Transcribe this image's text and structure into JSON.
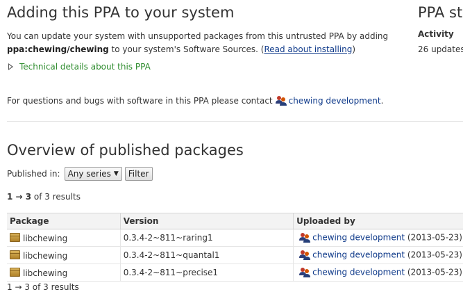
{
  "main": {
    "title": "Adding this PPA to your system",
    "intro_text": "You can update your system with unsupported packages from this untrusted PPA by adding",
    "ppa_name": "ppa:chewing/chewing",
    "intro_suffix": "to your system's Software Sources. (",
    "read_link": "Read about installing",
    "intro_close": ")",
    "details_label": "Technical details about this PPA",
    "contact_text": "For questions and bugs with software in this PPA please contact",
    "contact_link": "chewing development",
    "contact_end": "."
  },
  "sidebar": {
    "title": "PPA st",
    "activity_heading": "Activity",
    "updates_text": "26 updates a"
  },
  "overview": {
    "heading": "Overview of published packages",
    "published_label": "Published in:",
    "series_selected": "Any series",
    "filter_button": "Filter",
    "results_range": "1 → 3",
    "results_suffix": " of 3 results",
    "bottom_partial": "1 → 3 of 3 results"
  },
  "table": {
    "headers": [
      "Package",
      "Version",
      "Uploaded by"
    ],
    "rows": [
      {
        "package": "libchewing",
        "version": "0.3.4-2~811~raring1",
        "uploader": "chewing development",
        "date": "(2013-05-23)"
      },
      {
        "package": "libchewing",
        "version": "0.3.4-2~811~quantal1",
        "uploader": "chewing development",
        "date": "(2013-05-23)"
      },
      {
        "package": "libchewing",
        "version": "0.3.4-2~811~precise1",
        "uploader": "chewing development",
        "date": "(2013-05-23)"
      }
    ]
  },
  "colors": {
    "link": "#0f3a8a",
    "details_green": "#2c8b2c",
    "table_header_bg": "#f3f3f3"
  },
  "icons": {
    "team": "team-icon",
    "package": "package-icon",
    "expander": "expander-triangle-icon"
  }
}
